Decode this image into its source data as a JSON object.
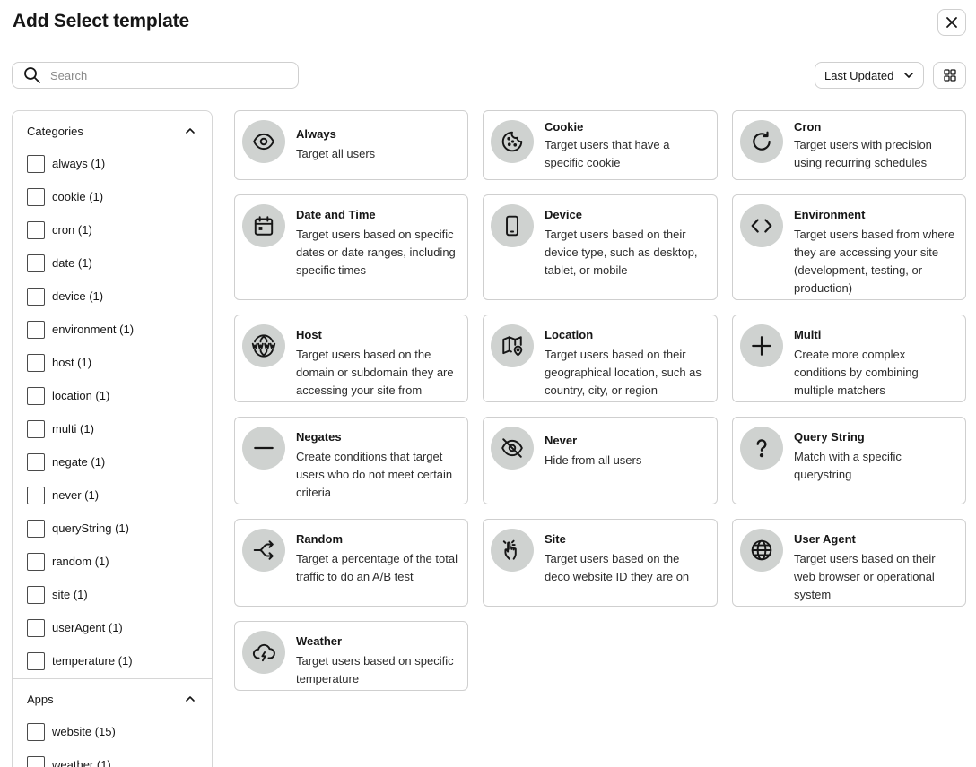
{
  "header": {
    "title": "Add Select template"
  },
  "toolbar": {
    "search_placeholder": "Search",
    "sort_label": "Last Updated"
  },
  "sidebar": {
    "categories_title": "Categories",
    "categories": [
      "always (1)",
      "cookie (1)",
      "cron (1)",
      "date (1)",
      "device (1)",
      "environment (1)",
      "host (1)",
      "location (1)",
      "multi (1)",
      "negate (1)",
      "never (1)",
      "queryString (1)",
      "random (1)",
      "site (1)",
      "userAgent (1)",
      "temperature (1)"
    ],
    "apps_title": "Apps",
    "apps": [
      "website (15)",
      "weather (1)"
    ]
  },
  "templates": [
    {
      "title": "Always",
      "desc": "Target all users",
      "icon": "eye-icon"
    },
    {
      "title": "Cookie",
      "desc": "Target users that have a specific cookie",
      "icon": "cookie-icon"
    },
    {
      "title": "Cron",
      "desc": "Target users with precision using recurring schedules",
      "icon": "refresh-icon"
    },
    {
      "title": "Date and Time",
      "desc": "Target users based on specific dates or date ranges, including specific times",
      "icon": "calendar-icon"
    },
    {
      "title": "Device",
      "desc": "Target users based on their device type, such as desktop, tablet, or mobile",
      "icon": "phone-icon"
    },
    {
      "title": "Environment",
      "desc": "Target users based from where they are accessing your site (development, testing, or production)",
      "icon": "code-icon"
    },
    {
      "title": "Host",
      "desc": "Target users based on the domain or subdomain they are accessing your site from",
      "icon": "www-globe-icon"
    },
    {
      "title": "Location",
      "desc": "Target users based on their geographical location, such as country, city, or region",
      "icon": "map-pin-icon"
    },
    {
      "title": "Multi",
      "desc": "Create more complex conditions by combining multiple matchers",
      "icon": "plus-icon"
    },
    {
      "title": "Negates",
      "desc": "Create conditions that target users who do not meet certain criteria",
      "icon": "minus-icon"
    },
    {
      "title": "Never",
      "desc": "Hide from all users",
      "icon": "eye-off-icon"
    },
    {
      "title": "Query String",
      "desc": "Match with a specific querystring",
      "icon": "question-icon"
    },
    {
      "title": "Random",
      "desc": "Target a percentage of the total traffic to do an A/B test",
      "icon": "split-arrows-icon"
    },
    {
      "title": "Site",
      "desc": "Target users based on the deco website ID they are on",
      "icon": "pointer-hand-icon"
    },
    {
      "title": "User Agent",
      "desc": "Target users based on their web browser or operational system",
      "icon": "globe-icon"
    },
    {
      "title": "Weather",
      "desc": "Target users based on specific temperature",
      "icon": "storm-cloud-icon"
    }
  ]
}
